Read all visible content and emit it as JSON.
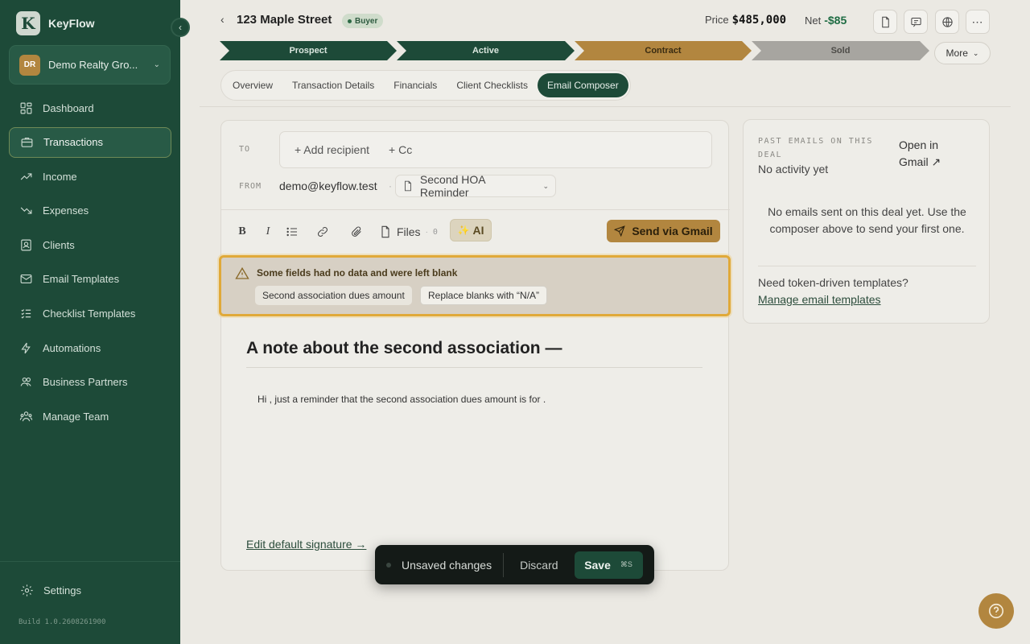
{
  "app": {
    "name": "KeyFlow",
    "logo_letter": "K",
    "build": "Build 1.0.2608261900"
  },
  "org": {
    "initials": "DR",
    "name": "Demo Realty Gro..."
  },
  "sidebar": {
    "items": [
      {
        "label": "Dashboard",
        "icon": "grid-icon"
      },
      {
        "label": "Transactions",
        "icon": "briefcase-icon",
        "active": true
      },
      {
        "label": "Income",
        "icon": "trend-up-icon"
      },
      {
        "label": "Expenses",
        "icon": "trend-down-icon"
      },
      {
        "label": "Clients",
        "icon": "contacts-icon"
      },
      {
        "label": "Email Templates",
        "icon": "mail-icon"
      },
      {
        "label": "Checklist Templates",
        "icon": "checklist-icon"
      },
      {
        "label": "Automations",
        "icon": "bolt-icon"
      },
      {
        "label": "Business Partners",
        "icon": "partners-icon"
      },
      {
        "label": "Manage Team",
        "icon": "team-icon"
      }
    ],
    "settings_label": "Settings"
  },
  "header": {
    "title": "123 Maple Street",
    "badge": "Buyer",
    "price_label": "Price",
    "price_value": "$485,000",
    "net_label": "Net",
    "net_value": "-$85"
  },
  "pipeline": {
    "stages": [
      "Prospect",
      "Active",
      "Contract",
      "Sold"
    ],
    "more_label": "More"
  },
  "tabs": [
    "Overview",
    "Transaction Details",
    "Financials",
    "Client Checklists",
    "Email Composer"
  ],
  "composer": {
    "to_label": "TO",
    "add_recipient": "+ Add recipient",
    "cc": "+ Cc",
    "from_label": "FROM",
    "from_value": "demo@keyflow.test",
    "template": "Second HOA Reminder",
    "files_label": "Files",
    "files_count": "0",
    "ai_label": "AI",
    "send_label": "Send via Gmail",
    "warning": {
      "title": "Some fields had no data and were left blank",
      "field": "Second association dues amount",
      "replace_label": "Replace blanks with “N/A”"
    },
    "body_title": "A note about the second association —",
    "body_text": "Hi , just a reminder that the second association dues amount is for .",
    "signature_link": "Edit default signature →"
  },
  "past_emails": {
    "label": "PAST EMAILS ON THIS DEAL",
    "status": "No activity yet",
    "open_gmail": "Open in Gmail ↗",
    "empty": "No emails sent on this deal yet. Use the composer above to send your first one.",
    "need_templates": "Need token-driven templates?",
    "manage_link": "Manage email templates"
  },
  "unsaved": {
    "text": "Unsaved changes",
    "discard": "Discard",
    "save": "Save",
    "shortcut": "⌘S"
  }
}
